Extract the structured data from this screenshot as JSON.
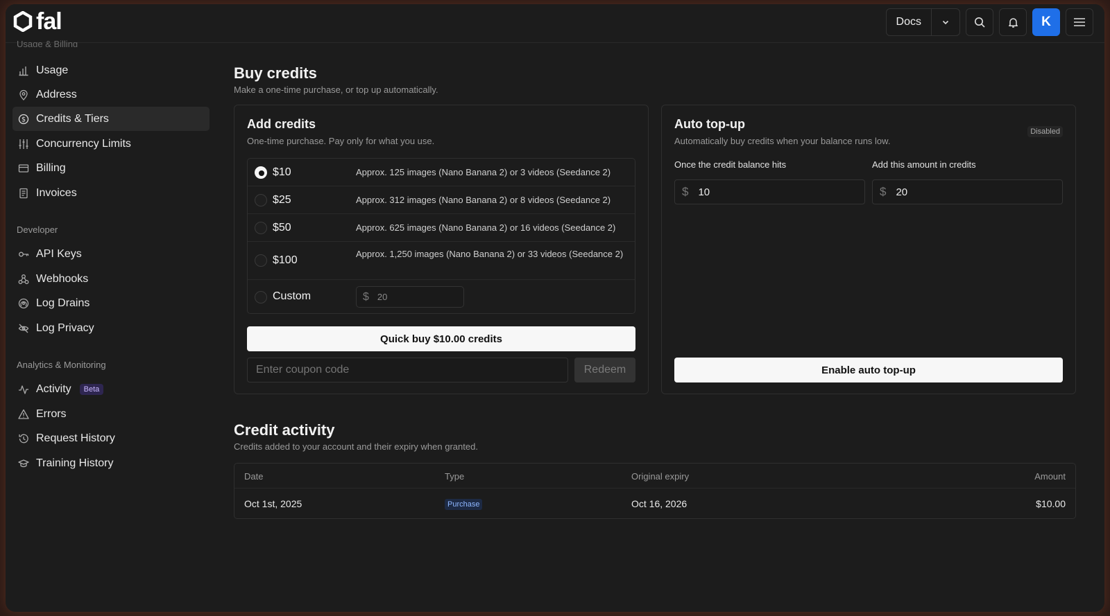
{
  "brand": {
    "name": "fal"
  },
  "topbar": {
    "docs_label": "Docs",
    "avatar_letter": "K"
  },
  "sidebar": {
    "cut_section": "Usage & Billing",
    "items_billing": [
      {
        "label": "Usage",
        "icon": "bar-chart-icon"
      },
      {
        "label": "Address",
        "icon": "map-pin-icon"
      },
      {
        "label": "Credits & Tiers",
        "icon": "dollar-circle-icon",
        "active": true
      },
      {
        "label": "Concurrency Limits",
        "icon": "sliders-icon"
      },
      {
        "label": "Billing",
        "icon": "credit-card-icon"
      },
      {
        "label": "Invoices",
        "icon": "receipt-icon"
      }
    ],
    "developer_title": "Developer",
    "items_developer": [
      {
        "label": "API Keys",
        "icon": "key-icon"
      },
      {
        "label": "Webhooks",
        "icon": "webhook-icon"
      },
      {
        "label": "Log Drains",
        "icon": "log-drain-icon"
      },
      {
        "label": "Log Privacy",
        "icon": "eye-off-icon"
      }
    ],
    "analytics_title": "Analytics & Monitoring",
    "items_analytics": [
      {
        "label": "Activity",
        "icon": "activity-icon",
        "badge": "Beta"
      },
      {
        "label": "Errors",
        "icon": "warning-icon"
      },
      {
        "label": "Request History",
        "icon": "history-icon"
      },
      {
        "label": "Training History",
        "icon": "graduation-cap-icon"
      }
    ]
  },
  "buy": {
    "title": "Buy credits",
    "subtitle": "Make a one-time purchase, or top up automatically."
  },
  "add_credits": {
    "title": "Add credits",
    "subtitle": "One-time purchase. Pay only for what you use.",
    "options": [
      {
        "price": "$10",
        "desc": "Approx. 125 images (Nano Banana 2) or 3 videos (Seedance 2)",
        "selected": true
      },
      {
        "price": "$25",
        "desc": "Approx. 312 images (Nano Banana 2) or 8 videos (Seedance 2)"
      },
      {
        "price": "$50",
        "desc": "Approx. 625 images (Nano Banana 2) or 16 videos (Seedance 2)"
      },
      {
        "price": "$100",
        "desc": "Approx. 1,250 images (Nano Banana 2) or 33 videos (Seedance 2)"
      }
    ],
    "custom_label": "Custom",
    "custom_placeholder": "20",
    "currency_symbol": "$",
    "quick_buy": "Quick buy $10.00 credits",
    "coupon_placeholder": "Enter coupon code",
    "redeem": "Redeem"
  },
  "auto_topup": {
    "title": "Auto top-up",
    "subtitle": "Automatically buy credits when your balance runs low.",
    "status": "Disabled",
    "threshold_label": "Once the credit balance hits",
    "threshold_value": "10",
    "amount_label": "Add this amount in credits",
    "amount_value": "20",
    "enable_button": "Enable auto top-up"
  },
  "activity": {
    "title": "Credit activity",
    "subtitle": "Credits added to your account and their expiry when granted.",
    "columns": [
      "Date",
      "Type",
      "Original expiry",
      "Amount"
    ],
    "rows": [
      {
        "date": "Oct 1st, 2025",
        "type": "Purchase",
        "expiry": "Oct 16, 2026",
        "amount": "$10.00"
      }
    ]
  }
}
